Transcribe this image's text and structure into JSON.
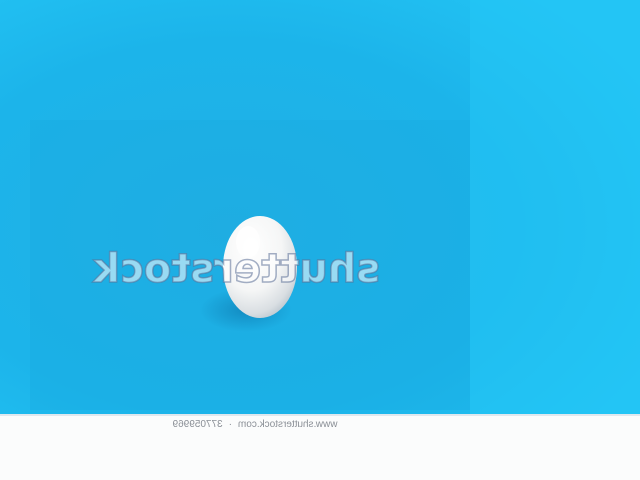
{
  "image": {
    "subject": "egg",
    "background_color": "#1fb5e8",
    "footer_color": "#fbfcfc"
  },
  "watermark": {
    "logo_text": "shutterstock",
    "site": "www.shutterstock.com",
    "separator": "·",
    "image_id": "377059969"
  }
}
